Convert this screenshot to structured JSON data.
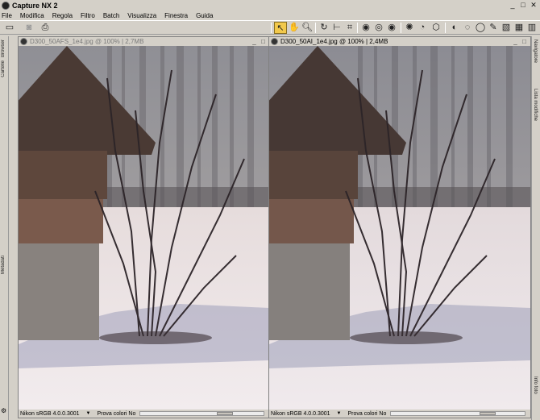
{
  "app": {
    "title": "Capture NX 2"
  },
  "menu": [
    "File",
    "Modifica",
    "Regola",
    "Filtro",
    "Batch",
    "Visualizza",
    "Finestra",
    "Guida"
  ],
  "left_panels": {
    "top": "Browser",
    "top2": "Cartelle",
    "bottom": "Metadati"
  },
  "right_panels": {
    "top": "Navigatore",
    "middle": "Lista modifiche",
    "bottom": "Info foto"
  },
  "windows": [
    {
      "title": "D300_50AFS_1e4.jpg @ 100% | 2,7MB",
      "status_profile": "Nikon sRGB 4.0.0.3001",
      "status_proof": "Prova colori No",
      "active": false
    },
    {
      "title": "D300_50AI_1e4.jpg @ 100% | 2,4MB",
      "status_profile": "Nikon sRGB 4.0.0.3001",
      "status_proof": "Prova colori No",
      "active": true
    }
  ],
  "colors": {
    "chrome": "#d4d0c8",
    "active_tool": "#f2c94c"
  }
}
